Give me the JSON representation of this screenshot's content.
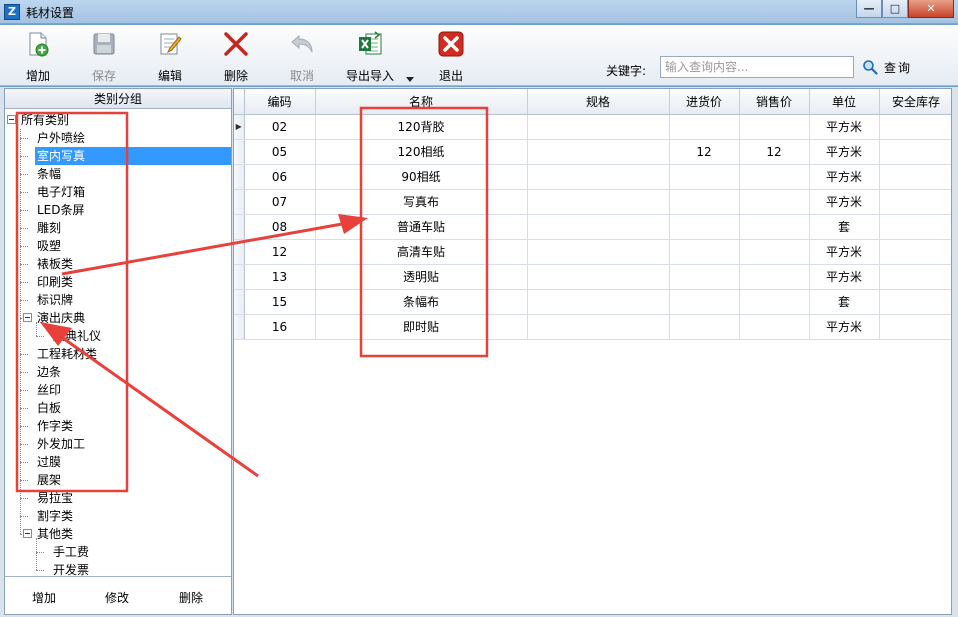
{
  "window": {
    "title": "耗材设置",
    "minimize_glyph": "—",
    "maximize_glyph": "□",
    "close_glyph": "✕"
  },
  "toolbar": {
    "buttons": [
      {
        "label": "增加",
        "icon": "add-document-icon",
        "enabled": true
      },
      {
        "label": "保存",
        "icon": "save-disk-icon",
        "enabled": false
      },
      {
        "label": "编辑",
        "icon": "edit-pencil-icon",
        "enabled": true
      },
      {
        "label": "删除",
        "icon": "delete-x-icon",
        "enabled": true
      },
      {
        "label": "取消",
        "icon": "undo-arrow-icon",
        "enabled": false
      },
      {
        "label": "导出导入",
        "icon": "excel-icon",
        "enabled": true
      },
      {
        "label": "退出",
        "icon": "exit-red-x-icon",
        "enabled": true
      }
    ],
    "keyword_label": "关键字:",
    "search_placeholder": "输入查询内容...",
    "search_label": "查询"
  },
  "category_panel": {
    "header": "类别分组",
    "tree": [
      {
        "label": "所有类别",
        "level": 0,
        "toggle": true
      },
      {
        "label": "户外喷绘",
        "level": 1
      },
      {
        "label": "室内写真",
        "level": 1,
        "selected": true
      },
      {
        "label": "条幅",
        "level": 1
      },
      {
        "label": "电子灯箱",
        "level": 1
      },
      {
        "label": "LED条屏",
        "level": 1
      },
      {
        "label": "雕刻",
        "level": 1
      },
      {
        "label": "吸塑",
        "level": 1
      },
      {
        "label": "裱板类",
        "level": 1
      },
      {
        "label": "印刷类",
        "level": 1
      },
      {
        "label": "标识牌",
        "level": 1
      },
      {
        "label": "演出庆典",
        "level": 1,
        "toggle": true
      },
      {
        "label": "庆典礼仪",
        "level": 2
      },
      {
        "label": "工程耗材类",
        "level": 1
      },
      {
        "label": "边条",
        "level": 1
      },
      {
        "label": "丝印",
        "level": 1
      },
      {
        "label": "白板",
        "level": 1
      },
      {
        "label": "作字类",
        "level": 1
      },
      {
        "label": "外发加工",
        "level": 1
      },
      {
        "label": "过膜",
        "level": 1
      },
      {
        "label": "展架",
        "level": 1
      },
      {
        "label": "易拉宝",
        "level": 1
      },
      {
        "label": "割字类",
        "level": 1
      },
      {
        "label": "其他类",
        "level": 1,
        "toggle": true
      },
      {
        "label": "手工费",
        "level": 2
      },
      {
        "label": "开发票",
        "level": 2
      }
    ],
    "footer": {
      "add": "增加",
      "modify": "修改",
      "delete": "删除"
    }
  },
  "grid": {
    "columns": [
      "编码",
      "名称",
      "规格",
      "进货价",
      "销售价",
      "单位",
      "安全库存"
    ],
    "rows": [
      [
        "02",
        "120背胶",
        "",
        "",
        "",
        "平方米",
        ""
      ],
      [
        "05",
        "120相纸",
        "",
        "12",
        "12",
        "平方米",
        ""
      ],
      [
        "06",
        "90相纸",
        "",
        "",
        "",
        "平方米",
        ""
      ],
      [
        "07",
        "写真布",
        "",
        "",
        "",
        "平方米",
        ""
      ],
      [
        "08",
        "普通车贴",
        "",
        "",
        "",
        "套",
        ""
      ],
      [
        "12",
        "高清车贴",
        "",
        "",
        "",
        "平方米",
        ""
      ],
      [
        "13",
        "透明贴",
        "",
        "",
        "",
        "平方米",
        ""
      ],
      [
        "15",
        "条幅布",
        "",
        "",
        "",
        "套",
        ""
      ],
      [
        "16",
        "即时贴",
        "",
        "",
        "",
        "平方米",
        ""
      ]
    ],
    "current_row_marker": "▶"
  },
  "colors": {
    "annotation_red": "#e8413b",
    "selection_blue": "#3399ff"
  }
}
